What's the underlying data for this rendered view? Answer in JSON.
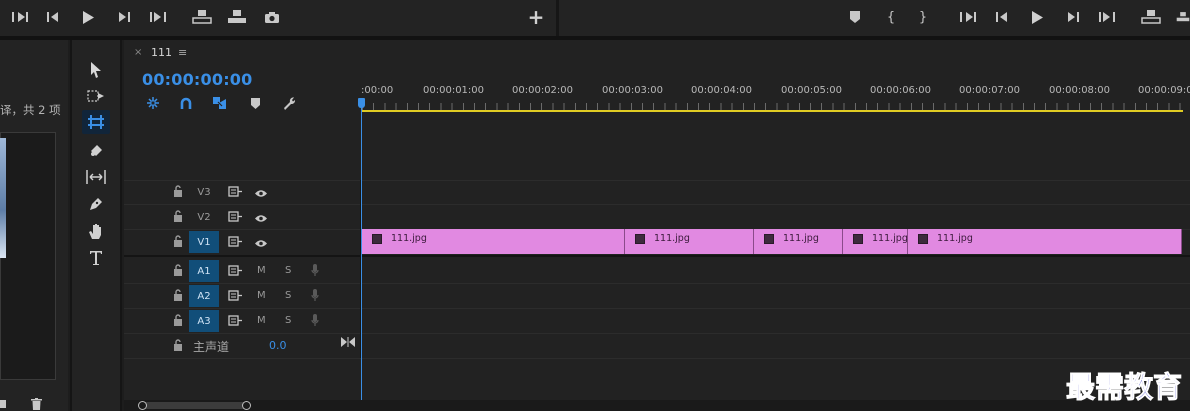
{
  "project_panel": {
    "item_count": "译，共 2 项"
  },
  "timeline": {
    "sequence_name": "111",
    "close_glyph": "×",
    "menu_glyph": "≡",
    "timecode": "00:00:00:00",
    "ruler_labels": [
      ":00:00",
      "00:00:01:00",
      "00:00:02:00",
      "00:00:03:00",
      "00:00:04:00",
      "00:00:05:00",
      "00:00:06:00",
      "00:00:07:00",
      "00:00:08:00",
      "00:00:09:0"
    ],
    "video_tracks": [
      {
        "name": "V3",
        "targeted": false
      },
      {
        "name": "V2",
        "targeted": false
      },
      {
        "name": "V1",
        "targeted": true
      }
    ],
    "audio_tracks": [
      {
        "name": "A1",
        "mute": "M",
        "solo": "S"
      },
      {
        "name": "A2",
        "mute": "M",
        "solo": "S"
      },
      {
        "name": "A3",
        "mute": "M",
        "solo": "S"
      }
    ],
    "master": {
      "label": "主声道",
      "value": "0.0"
    },
    "clips": [
      {
        "name": "111.jpg"
      },
      {
        "name": "111.jpg"
      },
      {
        "name": "111.jpg"
      },
      {
        "name": "111.jpg"
      },
      {
        "name": "111.jpg"
      }
    ],
    "add_glyph": "+"
  },
  "colors": {
    "accent": "#3a8fe6",
    "clip": "#e189e1",
    "work_area": "#e0cc23",
    "track_target": "#114e79"
  },
  "watermark": "最需教育"
}
